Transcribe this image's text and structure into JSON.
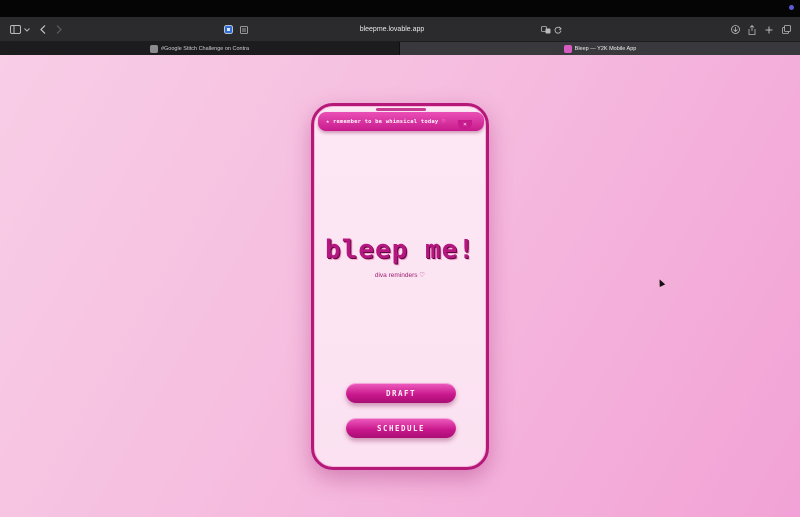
{
  "browser": {
    "url": "bleepme.lovable.app",
    "tabs": [
      {
        "title": "#Google Stitch Challenge on Contra",
        "active": false
      },
      {
        "title": "Bleep — Y2K Mobile App",
        "active": true
      }
    ]
  },
  "app": {
    "banner": "★ remember to be whimsical today ♡",
    "banner_close_icon": "close-icon",
    "title": "bleep me!",
    "subtitle": "diva reminders ♡",
    "buttons": {
      "draft": "DRAFT",
      "schedule": "SCHEDULE"
    }
  },
  "colors": {
    "accent": "#c71a8c",
    "background": "#f6bfe0",
    "phone_bg": "#fde8f4"
  }
}
